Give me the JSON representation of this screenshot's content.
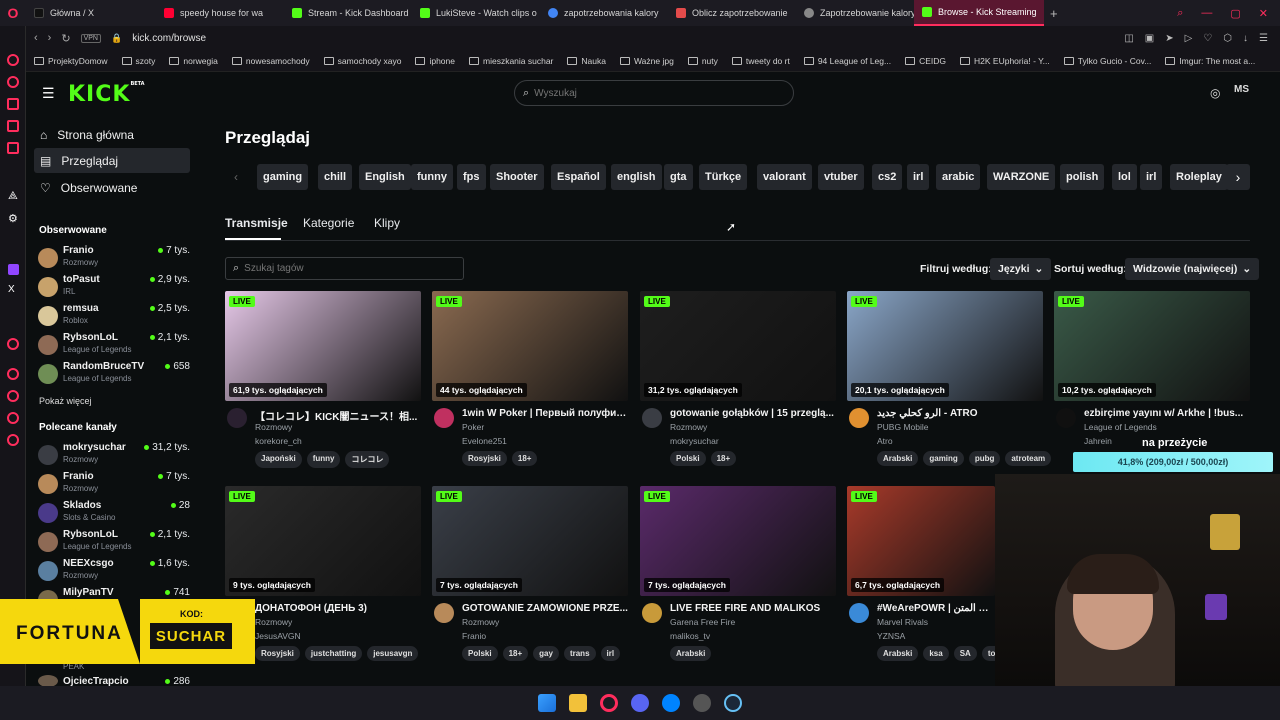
{
  "browser": {
    "tabs": [
      {
        "label": "Główna / X",
        "color": "#111111",
        "active": false
      },
      {
        "label": "speedy house for wa",
        "color": "#ff0033",
        "active": false
      },
      {
        "label": "Stream - Kick Dashboard",
        "color": "#53fc18",
        "active": false
      },
      {
        "label": "LukiSteve - Watch clips o",
        "color": "#53fc18",
        "active": false
      },
      {
        "label": "zapotrzebowania kalory",
        "color": "#4285f4",
        "active": false
      },
      {
        "label": "Oblicz zapotrzebowanie",
        "color": "#e34b4b",
        "active": false
      },
      {
        "label": "Zapotrzebowanie kaloryc",
        "color": "#888888",
        "active": false
      },
      {
        "label": "Browse - Kick Streaming",
        "color": "#53fc18",
        "active": true
      }
    ],
    "new_tab": "+",
    "vpn": "VPN",
    "url": "kick.com/browse",
    "bookmarks": [
      "ProjektyDomow",
      "szoty",
      "norwegia",
      "nowesamochody",
      "samochody xayo",
      "iphone",
      "mieszkania suchar",
      "Nauka",
      "Ważne jpg",
      "nuty",
      "tweety do rt",
      "94 League of Leg...",
      "CEIDG",
      "H2K EUphoria! - Y...",
      "Tylko Gucio - Cov...",
      "Imgur: The most a..."
    ]
  },
  "header": {
    "logo": "KICK",
    "logo_beta": "BETA",
    "search_placeholder": "Wyszukaj",
    "user_initials": "MS"
  },
  "nav": {
    "home": "Strona główna",
    "browse": "Przeglądaj",
    "following": "Obserwowane"
  },
  "followed": {
    "title": "Obserwowane",
    "channels": [
      {
        "name": "Franio",
        "category": "Rozmowy",
        "viewers": "7 tys.",
        "color": "#b88a5a"
      },
      {
        "name": "toPasut",
        "category": "IRL",
        "viewers": "2,9 tys.",
        "color": "#c7a26b"
      },
      {
        "name": "remsua",
        "category": "Roblox",
        "viewers": "2,5 tys.",
        "color": "#d9c79a"
      },
      {
        "name": "RybsonLoL",
        "category": "League of Legends",
        "viewers": "2,1 tys.",
        "color": "#8e6a55"
      },
      {
        "name": "RandomBruceTV",
        "category": "League of Legends",
        "viewers": "658",
        "color": "#6f8e55"
      }
    ],
    "show_more": "Pokaż więcej"
  },
  "recommended": {
    "title": "Polecane kanały",
    "channels": [
      {
        "name": "mokrysuchar",
        "category": "Rozmowy",
        "viewers": "31,2 tys.",
        "color": "#3a3d44"
      },
      {
        "name": "Franio",
        "category": "Rozmowy",
        "viewers": "7 tys.",
        "color": "#b88a5a"
      },
      {
        "name": "Sklados",
        "category": "Slots & Casino",
        "viewers": "28",
        "color": "#4a3a8a"
      },
      {
        "name": "RybsonLoL",
        "category": "League of Legends",
        "viewers": "2,1 tys.",
        "color": "#8e6a55"
      },
      {
        "name": "NEEXcsgo",
        "category": "Rozmowy",
        "viewers": "1,6 tys.",
        "color": "#5a7fa0"
      },
      {
        "name": "MilyPanTV",
        "category": "",
        "viewers": "741",
        "color": "#7a6a4a"
      }
    ],
    "partial": {
      "name": "OjciecTrapcio",
      "category": "PEAK",
      "viewers": "286"
    }
  },
  "page": {
    "title": "Przeglądaj",
    "tags": [
      "gaming",
      "chill",
      "English",
      "funny",
      "fps",
      "Shooter",
      "Español",
      "english",
      "gta",
      "Türkçe",
      "valorant",
      "vtuber",
      "cs2",
      "irl",
      "arabic",
      "WARZONE",
      "polish",
      "lol",
      "irl",
      "Roleplay"
    ],
    "subtabs": [
      "Transmisje",
      "Kategorie",
      "Klipy"
    ],
    "tag_search_placeholder": "Szukaj tagów",
    "filter_label": "Filtruj według:",
    "filter_value": "Języki",
    "sort_label": "Sortuj według:",
    "sort_value": "Widzowie (najwięcej)"
  },
  "streams": [
    {
      "title": "【コレコレ】KICK闇ニュース！相...",
      "category": "Rozmowy",
      "user": "korekore_ch",
      "viewers": "61,9 tys. oglądających",
      "tags": [
        "Japoński",
        "funny",
        "コレコレ"
      ],
      "thumb": "#e6c8e8",
      "avatar": "#2a2030"
    },
    {
      "title": "1win W Poker | Первый полуфин...",
      "category": "Poker",
      "user": "Evelone251",
      "viewers": "44 tys. oglądających",
      "tags": [
        "Rosyjski",
        "18+"
      ],
      "thumb": "#8a6a50",
      "avatar": "#c03060"
    },
    {
      "title": "gotowanie gołąbków | 15 przeglą...",
      "category": "Rozmowy",
      "user": "mokrysuchar",
      "viewers": "31,2 tys. oglądających",
      "tags": [
        "Polski",
        "18+"
      ],
      "thumb": "#1e1e1e",
      "avatar": "#3a3d44"
    },
    {
      "title": "الرو كحلي جديد - ATRO",
      "category": "PUBG Mobile",
      "user": "Atro",
      "viewers": "20,1 tys. oglądających",
      "tags": [
        "Arabski",
        "gaming",
        "pubg",
        "atroteam"
      ],
      "thumb": "#8aa6c8",
      "avatar": "#e09030"
    },
    {
      "title": "ezbirçime yayını w/ Arkhe | !bus...",
      "category": "League of Legends",
      "user": "Jahrein",
      "viewers": "10,2 tys. oglądających",
      "tags": [],
      "thumb": "#3a5a48",
      "avatar": "#101010"
    },
    {
      "title": "ДОНАТОФОН (ДЕНЬ 3)",
      "category": "Rozmowy",
      "user": "JesusAVGN",
      "viewers": "9 tys. oglądających",
      "tags": [
        "Rosyjski",
        "justchatting",
        "jesusavgn"
      ],
      "thumb": "#2a2a2a",
      "avatar": "#1a1a1a"
    },
    {
      "title": "GOTOWANIE ZAMÓWIONE PRZE...",
      "category": "Rozmowy",
      "user": "Franio",
      "viewers": "7 tys. oglądających",
      "tags": [
        "Polski",
        "18+",
        "gay",
        "trans",
        "irl"
      ],
      "thumb": "#3a3f48",
      "avatar": "#b88a5a"
    },
    {
      "title": "LIVE FREE FIRE AND MALIKOS",
      "category": "Garena Free Fire",
      "user": "malikos_tv",
      "viewers": "7 tys. oglądających",
      "tags": [
        "Arabski"
      ],
      "thumb": "#5a2a6a",
      "avatar": "#c89a3a"
    },
    {
      "title": "#WeArePOWR | يحساب المتن",
      "category": "Marvel Rivals",
      "user": "YZNSA",
      "viewers": "6,7 tys. oglądających",
      "tags": [
        "Arabski",
        "ksa",
        "SA",
        "top1"
      ],
      "thumb": "#a83a2a",
      "avatar": "#3a8ad8"
    }
  ],
  "overlays": {
    "fortuna_logo": "FORTUNA",
    "code_label": "KOD:",
    "code": "SUCHAR",
    "goal_title": "na przeżycie",
    "goal_progress": "41,8% (209,00zł / 500,00zł)",
    "goal_fraction": 0.418
  },
  "colors": {
    "accent": "#53fc18",
    "live": "#53fc18",
    "browser_accent": "#ff2d5d"
  }
}
